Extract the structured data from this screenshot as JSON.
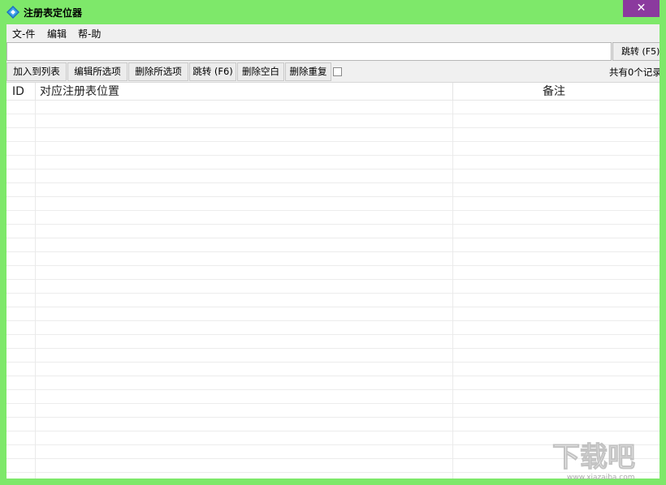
{
  "window": {
    "title": "注册表定位器",
    "close_glyph": "✕",
    "app_icon": "diamond-app-icon"
  },
  "menu": [
    {
      "label": "文-件"
    },
    {
      "label": "编辑"
    },
    {
      "label": "帮-助"
    }
  ],
  "address": {
    "value": "",
    "placeholder": "",
    "jump_label": "跳转 (F5)"
  },
  "toolbar": {
    "add_to_list": "加入到列表",
    "edit_selected": "编辑所选项",
    "delete_selected": "删除所选项",
    "jump_f6": "跳转 (F6)",
    "delete_blank": "删除空白",
    "delete_duplicate": "删除重复",
    "checkbox_checked": false,
    "record_count": "共有0个记录"
  },
  "list": {
    "columns": [
      "ID",
      "对应注册表位置",
      "备注"
    ],
    "rows": []
  },
  "watermark": {
    "text": "下载吧",
    "sub": "www.xiazaiba.com"
  }
}
